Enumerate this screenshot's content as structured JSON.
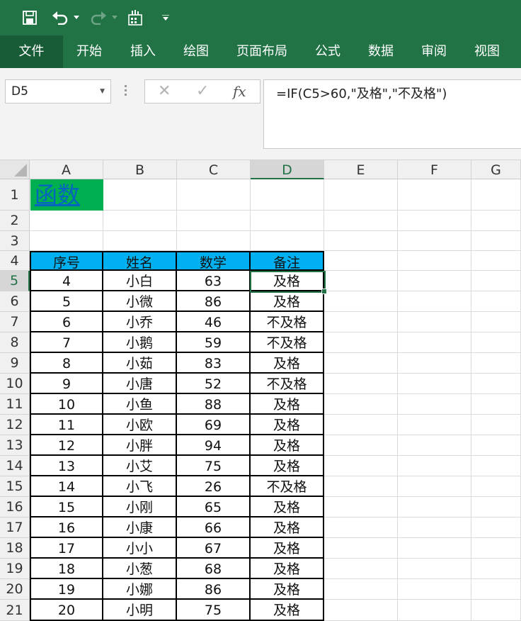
{
  "toolbar": {
    "save_icon": "save-icon",
    "undo_icon": "undo-icon",
    "redo_icon": "redo-icon",
    "touch_icon": "touch-mode-icon",
    "customize_icon": "customize-qat-icon"
  },
  "ribbon": {
    "tabs": [
      "文件",
      "开始",
      "插入",
      "绘图",
      "页面布局",
      "公式",
      "数据",
      "审阅",
      "视图"
    ]
  },
  "formula_bar": {
    "name_box": "D5",
    "cancel_glyph": "✕",
    "enter_glyph": "✓",
    "fx_glyph": "fx",
    "formula": "=IF(C5>60,\"及格\",\"不及格\")"
  },
  "sheet": {
    "columns": [
      "A",
      "B",
      "C",
      "D",
      "E",
      "F",
      "G"
    ],
    "rows": [
      "1",
      "2",
      "3",
      "4",
      "5",
      "6",
      "7",
      "8",
      "9",
      "10",
      "11",
      "12",
      "13",
      "14",
      "15",
      "16",
      "17",
      "18",
      "19",
      "20",
      "21"
    ],
    "title": "函数",
    "headers": [
      "序号",
      "姓名",
      "数学",
      "备注"
    ],
    "data": [
      [
        "4",
        "小白",
        "63",
        "及格"
      ],
      [
        "5",
        "小微",
        "86",
        "及格"
      ],
      [
        "6",
        "小乔",
        "46",
        "不及格"
      ],
      [
        "7",
        "小鹅",
        "59",
        "不及格"
      ],
      [
        "8",
        "小茹",
        "83",
        "及格"
      ],
      [
        "9",
        "小唐",
        "52",
        "不及格"
      ],
      [
        "10",
        "小鱼",
        "88",
        "及格"
      ],
      [
        "11",
        "小欧",
        "69",
        "及格"
      ],
      [
        "12",
        "小胖",
        "94",
        "及格"
      ],
      [
        "13",
        "小艾",
        "75",
        "及格"
      ],
      [
        "14",
        "小飞",
        "26",
        "不及格"
      ],
      [
        "15",
        "小刚",
        "65",
        "及格"
      ],
      [
        "16",
        "小康",
        "66",
        "及格"
      ],
      [
        "17",
        "小小",
        "67",
        "及格"
      ],
      [
        "18",
        "小葱",
        "68",
        "及格"
      ],
      [
        "19",
        "小娜",
        "86",
        "及格"
      ],
      [
        "20",
        "小明",
        "75",
        "及格"
      ]
    ],
    "active_cell": "D5"
  },
  "colors": {
    "ribbon_green": "#217346",
    "file_tab": "#185c37",
    "header_fill": "#00b0f0",
    "title_fill": "#00b050",
    "link_blue": "#0563c1"
  }
}
